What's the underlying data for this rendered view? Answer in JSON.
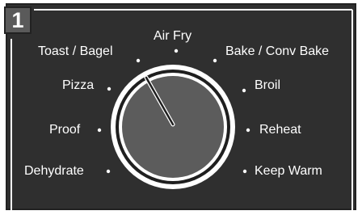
{
  "step": {
    "number": "1"
  },
  "dial": {
    "settings": [
      {
        "id": "air-fry",
        "label": "Air Fry"
      },
      {
        "id": "toast-bagel",
        "label": "Toast / Bagel"
      },
      {
        "id": "bake-conv-bake",
        "label": "Bake / Conv Bake"
      },
      {
        "id": "pizza",
        "label": "Pizza"
      },
      {
        "id": "broil",
        "label": "Broil"
      },
      {
        "id": "proof",
        "label": "Proof"
      },
      {
        "id": "reheat",
        "label": "Reheat"
      },
      {
        "id": "dehydrate",
        "label": "Dehydrate"
      },
      {
        "id": "keep-warm",
        "label": "Keep Warm"
      }
    ],
    "selected": "toast-bagel"
  },
  "colors": {
    "panel": "#2f2f2f",
    "knob_face": "#5c5c5c",
    "knob_ring": "#ffffff",
    "text": "#ffffff"
  }
}
